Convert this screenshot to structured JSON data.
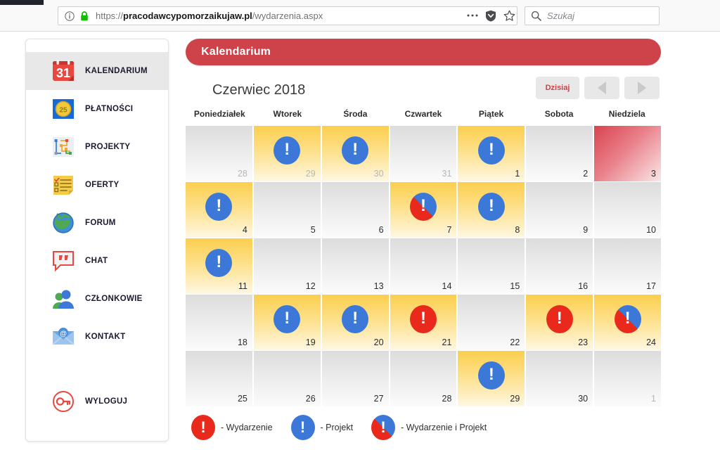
{
  "browser": {
    "url_scheme": "https://",
    "url_domain": "pracodawcypomorzaikujaw.pl",
    "url_path": "/wydarzenia.aspx",
    "search_placeholder": "Szukaj",
    "info_icon": "info-icon",
    "lock_icon": "lock-icon",
    "menu_icon": "ellipsis-icon",
    "shield_icon": "shield-icon",
    "star_icon": "star-icon",
    "search_icon": "search-icon"
  },
  "sidebar": {
    "items": [
      {
        "label": "KALENDARIUM",
        "icon": "calendar-icon",
        "active": true
      },
      {
        "label": "PŁATNOŚCI",
        "icon": "coin-icon",
        "active": false
      },
      {
        "label": "PROJEKTY",
        "icon": "projects-icon",
        "active": false
      },
      {
        "label": "OFERTY",
        "icon": "offers-icon",
        "active": false
      },
      {
        "label": "FORUM",
        "icon": "globe-icon",
        "active": false
      },
      {
        "label": "CHAT",
        "icon": "chat-icon",
        "active": false
      },
      {
        "label": "CZŁONKOWIE",
        "icon": "members-icon",
        "active": false
      },
      {
        "label": "KONTAKT",
        "icon": "envelope-icon",
        "active": false
      }
    ],
    "logout": {
      "label": "WYLOGUJ",
      "icon": "key-icon"
    }
  },
  "panel": {
    "title": "Kalendarium",
    "accent_color": "#cd4349"
  },
  "calendar": {
    "month_title": "Czerwiec 2018",
    "today_button": "Dzisiaj",
    "prev_button_icon": "chevron-left-icon",
    "next_button_icon": "chevron-right-icon",
    "weekdays": [
      "Poniedziałek",
      "Wtorek",
      "Środa",
      "Czwartek",
      "Piątek",
      "Sobota",
      "Niedziela"
    ],
    "days": [
      {
        "num": "28",
        "state": "out",
        "badge": "none"
      },
      {
        "num": "29",
        "state": "out",
        "badge": "blue",
        "highlight": "event"
      },
      {
        "num": "30",
        "state": "out",
        "badge": "blue",
        "highlight": "event"
      },
      {
        "num": "31",
        "state": "out",
        "badge": "none"
      },
      {
        "num": "1",
        "state": "in",
        "badge": "blue",
        "highlight": "event"
      },
      {
        "num": "2",
        "state": "in",
        "badge": "none"
      },
      {
        "num": "3",
        "state": "in",
        "badge": "none",
        "highlight": "sunday"
      },
      {
        "num": "4",
        "state": "in",
        "badge": "blue",
        "highlight": "event"
      },
      {
        "num": "5",
        "state": "in",
        "badge": "none"
      },
      {
        "num": "6",
        "state": "in",
        "badge": "none"
      },
      {
        "num": "7",
        "state": "in",
        "badge": "both",
        "highlight": "event"
      },
      {
        "num": "8",
        "state": "in",
        "badge": "blue",
        "highlight": "event"
      },
      {
        "num": "9",
        "state": "in",
        "badge": "none"
      },
      {
        "num": "10",
        "state": "in",
        "badge": "none"
      },
      {
        "num": "11",
        "state": "in",
        "badge": "blue",
        "highlight": "event"
      },
      {
        "num": "12",
        "state": "in",
        "badge": "none"
      },
      {
        "num": "13",
        "state": "in",
        "badge": "none"
      },
      {
        "num": "14",
        "state": "in",
        "badge": "none"
      },
      {
        "num": "15",
        "state": "in",
        "badge": "none"
      },
      {
        "num": "16",
        "state": "in",
        "badge": "none"
      },
      {
        "num": "17",
        "state": "in",
        "badge": "none"
      },
      {
        "num": "18",
        "state": "in",
        "badge": "none"
      },
      {
        "num": "19",
        "state": "in",
        "badge": "blue",
        "highlight": "event"
      },
      {
        "num": "20",
        "state": "in",
        "badge": "blue",
        "highlight": "event"
      },
      {
        "num": "21",
        "state": "in",
        "badge": "red",
        "highlight": "event"
      },
      {
        "num": "22",
        "state": "in",
        "badge": "none"
      },
      {
        "num": "23",
        "state": "in",
        "badge": "red",
        "highlight": "event"
      },
      {
        "num": "24",
        "state": "in",
        "badge": "both",
        "highlight": "event"
      },
      {
        "num": "25",
        "state": "in",
        "badge": "none"
      },
      {
        "num": "26",
        "state": "in",
        "badge": "none"
      },
      {
        "num": "27",
        "state": "in",
        "badge": "none"
      },
      {
        "num": "28",
        "state": "in",
        "badge": "none"
      },
      {
        "num": "29",
        "state": "in",
        "badge": "blue",
        "highlight": "event"
      },
      {
        "num": "30",
        "state": "in",
        "badge": "none"
      },
      {
        "num": "1",
        "state": "out",
        "badge": "none"
      }
    ],
    "badge_glyph": "!",
    "legend": [
      {
        "type": "red",
        "text": "- Wydarzenie"
      },
      {
        "type": "blue",
        "text": "- Projekt"
      },
      {
        "type": "both",
        "text": "- Wydarzenie i Projekt"
      }
    ]
  }
}
